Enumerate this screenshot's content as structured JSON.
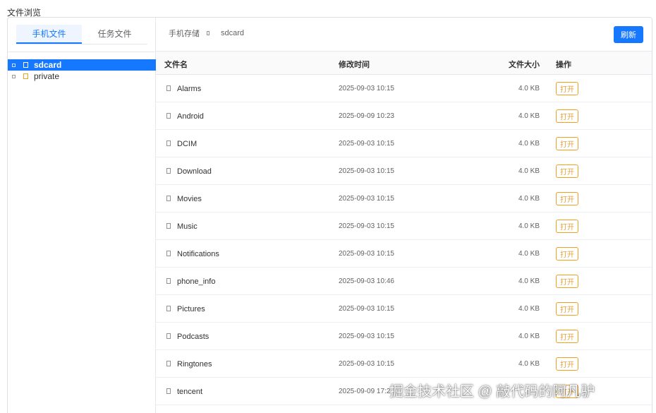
{
  "page_title": "文件浏览",
  "sidebar": {
    "tabs": [
      {
        "label": "手机文件",
        "active": true
      },
      {
        "label": "任务文件",
        "active": false
      }
    ],
    "tree": [
      {
        "label": "sdcard",
        "selected": true
      },
      {
        "label": "private",
        "selected": false
      }
    ]
  },
  "toolbar": {
    "breadcrumb": [
      "手机存储",
      "sdcard"
    ],
    "refresh_label": "刷新"
  },
  "table": {
    "headers": {
      "name": "文件名",
      "time": "修改时间",
      "size": "文件大小",
      "action": "操作"
    },
    "open_label": "打开",
    "rows": [
      {
        "name": "Alarms",
        "time": "2025-09-03 10:15",
        "size": "4.0 KB"
      },
      {
        "name": "Android",
        "time": "2025-09-09 10:23",
        "size": "4.0 KB"
      },
      {
        "name": "DCIM",
        "time": "2025-09-03 10:15",
        "size": "4.0 KB"
      },
      {
        "name": "Download",
        "time": "2025-09-03 10:15",
        "size": "4.0 KB"
      },
      {
        "name": "Movies",
        "time": "2025-09-03 10:15",
        "size": "4.0 KB"
      },
      {
        "name": "Music",
        "time": "2025-09-03 10:15",
        "size": "4.0 KB"
      },
      {
        "name": "Notifications",
        "time": "2025-09-03 10:15",
        "size": "4.0 KB"
      },
      {
        "name": "phone_info",
        "time": "2025-09-03 10:46",
        "size": "4.0 KB"
      },
      {
        "name": "Pictures",
        "time": "2025-09-03 10:15",
        "size": "4.0 KB"
      },
      {
        "name": "Podcasts",
        "time": "2025-09-03 10:15",
        "size": "4.0 KB"
      },
      {
        "name": "Ringtones",
        "time": "2025-09-03 10:15",
        "size": "4.0 KB"
      },
      {
        "name": "tencent",
        "time": "2025-09-09 17:2",
        "size": ""
      }
    ]
  },
  "watermark": "掘金技术社区 @ 敲代码的阿凡驴",
  "colors": {
    "accent": "#1677ff",
    "open_button": "#f0a020"
  }
}
